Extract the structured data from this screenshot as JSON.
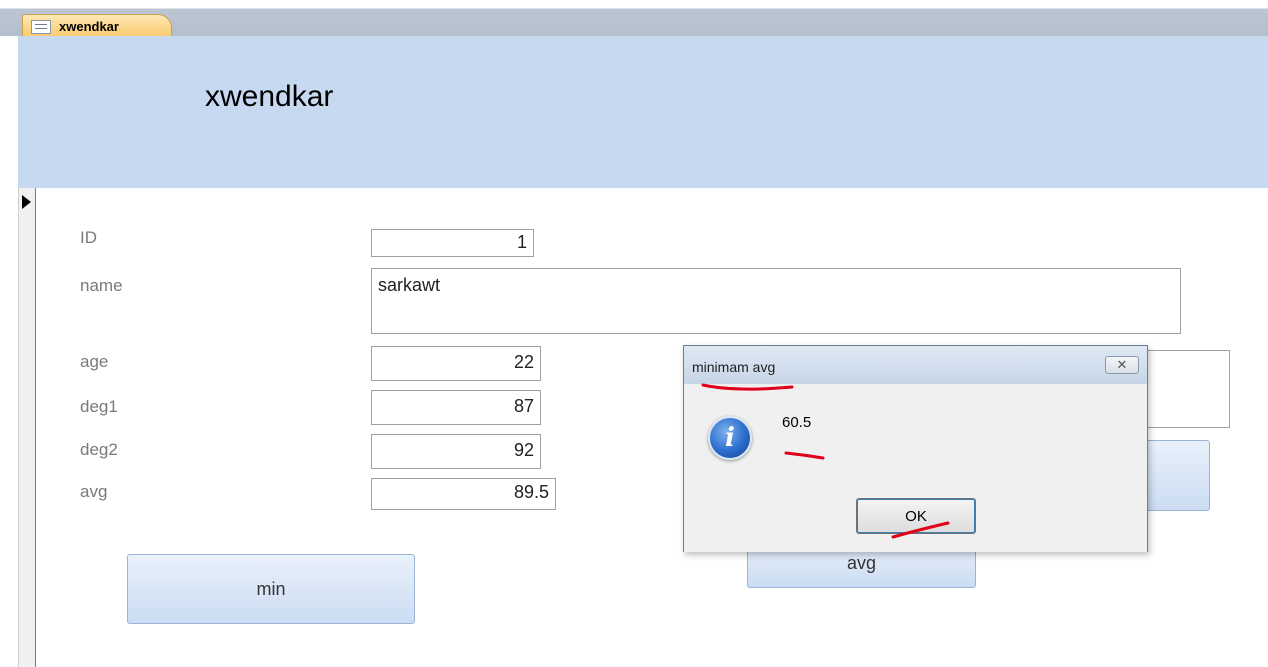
{
  "tab": {
    "icon": "form-icon",
    "label": "xwendkar"
  },
  "form": {
    "title": "xwendkar"
  },
  "record_selector": {
    "icon": "current-record-arrow-icon"
  },
  "fields": {
    "id": {
      "label": "ID",
      "value": "1"
    },
    "name": {
      "label": "name",
      "value": "sarkawt"
    },
    "age": {
      "label": "age",
      "value": "22"
    },
    "deg1": {
      "label": "deg1",
      "value": "87"
    },
    "deg2": {
      "label": "deg2",
      "value": "92"
    },
    "avg": {
      "label": "avg",
      "value": "89.5"
    }
  },
  "buttons": {
    "min": "min",
    "avg": "avg"
  },
  "dialog": {
    "title": "minimam avg",
    "close_icon": "close-icon",
    "icon": "info-icon",
    "message": "60.5",
    "ok_label": "OK"
  },
  "colors": {
    "header_bg": "#c6d9f1",
    "tab_bg": "#f9c86a",
    "annotation": "#e0001a"
  }
}
